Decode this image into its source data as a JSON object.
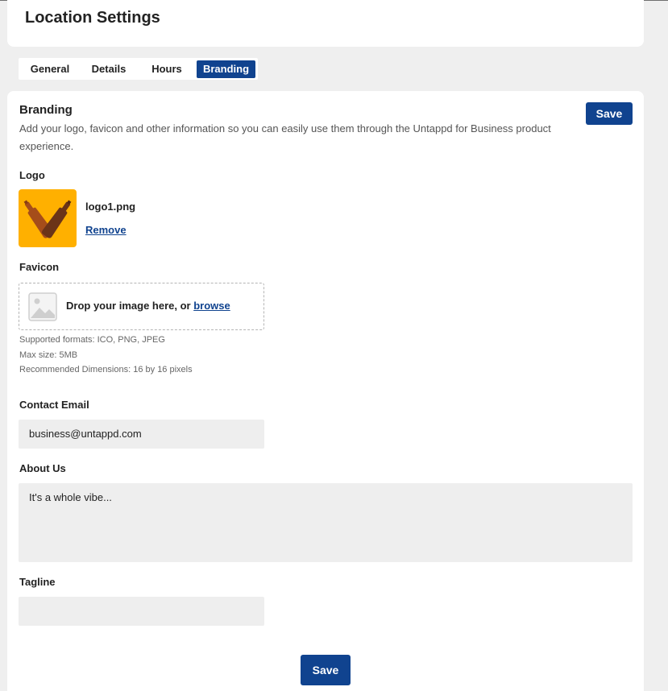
{
  "header": {
    "title": "Location Settings"
  },
  "tabs": [
    {
      "label": "General"
    },
    {
      "label": "Details"
    },
    {
      "label": "Hours"
    },
    {
      "label": "Branding",
      "active": true
    }
  ],
  "branding": {
    "title": "Branding",
    "description": "Add your logo, favicon and other information so you can easily use them through the Untappd for Business product experience.",
    "save_label": "Save"
  },
  "logo": {
    "label": "Logo",
    "filename": "logo1.png",
    "remove_label": "Remove",
    "icon": "beer-bottles-icon",
    "bg_color": "#ffb000"
  },
  "favicon": {
    "label": "Favicon",
    "drop_text": "Drop your image here, or ",
    "browse_label": "browse",
    "formats": "Supported formats: ICO, PNG, JPEG",
    "max_size": "Max size: 5MB",
    "dimensions": "Recommended Dimensions: 16 by 16 pixels"
  },
  "contact_email": {
    "label": "Contact Email",
    "value": "business@untappd.com"
  },
  "about_us": {
    "label": "About Us",
    "value": "It's a whole vibe..."
  },
  "tagline": {
    "label": "Tagline",
    "value": ""
  },
  "footer": {
    "save_label": "Save"
  },
  "colors": {
    "accent": "#10438f",
    "background": "#efefef",
    "input_bg": "#eeeeee"
  }
}
